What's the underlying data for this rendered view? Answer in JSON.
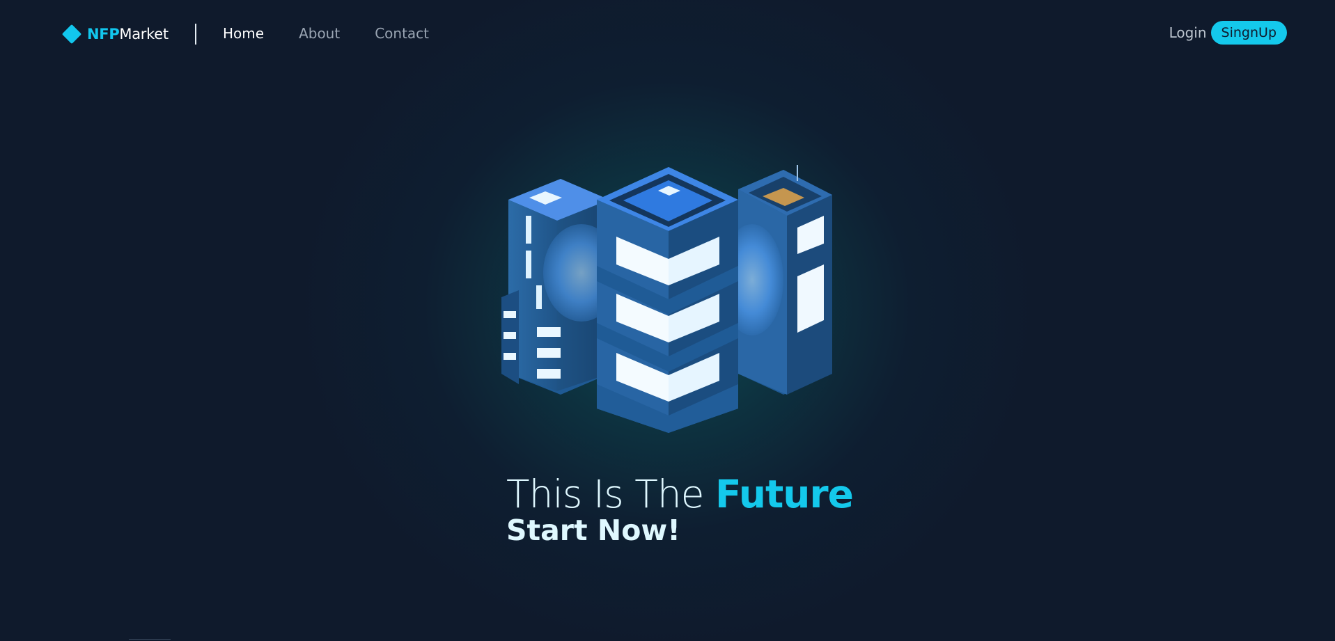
{
  "brand": {
    "bold": "NFP",
    "light": "Market",
    "icon": "diamond-icon",
    "accent_color": "#12c7ee"
  },
  "nav": {
    "links": [
      {
        "label": "Home",
        "active": true
      },
      {
        "label": "About",
        "active": false
      },
      {
        "label": "Contact",
        "active": false
      }
    ]
  },
  "auth": {
    "login_label": "Login",
    "signup_label": "SingnUp"
  },
  "hero": {
    "headline_prefix": "This Is The ",
    "headline_accent": "Future",
    "subline": "Start Now!",
    "illustration": "isometric-buildings-illustration"
  },
  "colors": {
    "background": "#0f1a2c",
    "accent": "#14c9ec",
    "text_light": "#dff8ff",
    "nav_muted": "#9aa5b3"
  }
}
